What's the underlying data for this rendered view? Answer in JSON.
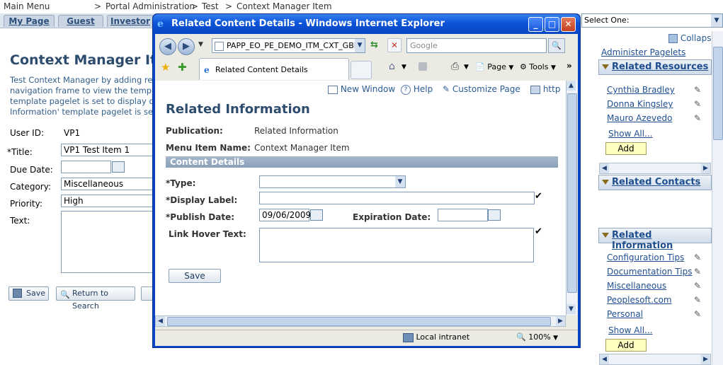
{
  "breadcrumb": {
    "main_menu": "Main Menu",
    "portal_admin": "Portal Administration",
    "test": "Test",
    "current": "Context Manager Item",
    "sep": ">"
  },
  "portal_tabs": [
    "My Page",
    "Guest",
    "Investor"
  ],
  "select_one": "Select One:",
  "left_page": {
    "title": "Context Manager Item",
    "desc_lines": [
      "Test Context Manager by adding rela",
      "navigation frame to view the template",
      "template pagelet is set to display diff",
      "Information' template pagelet is set to"
    ],
    "user_id_label": "User ID:",
    "user_id_value": "VP1",
    "title_label": "*Title:",
    "title_value": "VP1 Test Item 1",
    "due_date_label": "Due Date:",
    "category_label": "Category:",
    "category_value": "Miscellaneous",
    "priority_label": "Priority:",
    "priority_value": "High",
    "text_label": "Text:",
    "save_label": "Save",
    "return_label": "Return to Search"
  },
  "sidebar": {
    "collapse": "Collapse",
    "administer": "Administer Pagelets",
    "related_resources": {
      "title": "Related Resources",
      "items": [
        "Cynthia Bradley",
        "Donna Kingsley",
        "Mauro Azevedo"
      ],
      "show_all": "Show All...",
      "add": "Add"
    },
    "related_contacts": {
      "title": "Related Contacts"
    },
    "related_information": {
      "title": "Related Information",
      "items": [
        "Configuration Tips",
        "Documentation Tips",
        "Miscellaneous",
        "Peoplesoft.com",
        "Personal"
      ],
      "show_all": "Show All...",
      "add": "Add"
    }
  },
  "ie": {
    "window_title": "Related Content Details - Windows Internet Explorer",
    "address": "PAPP_EO_PE_DEMO_ITM_CXT_GBL",
    "search_placeholder": "Google",
    "tab_title": "Related Content Details",
    "page_menu": "Page",
    "tools_menu": "Tools",
    "status_zone": "Local intranet",
    "zoom": "100%"
  },
  "dialog": {
    "new_window": "New Window",
    "help": "Help",
    "customize_page": "Customize Page",
    "http": "http",
    "heading": "Related Information",
    "publication_label": "Publication:",
    "publication_value": "Related Information",
    "menu_item_label": "Menu Item Name:",
    "menu_item_value": "Context Manager Item",
    "section_title": "Content Details",
    "type_label": "*Type:",
    "display_label_label": "*Display Label:",
    "publish_date_label": "*Publish Date:",
    "publish_date_value": "09/06/2009",
    "expiration_label": "Expiration Date:",
    "link_hover_label": "Link Hover Text:",
    "save_label": "Save"
  }
}
